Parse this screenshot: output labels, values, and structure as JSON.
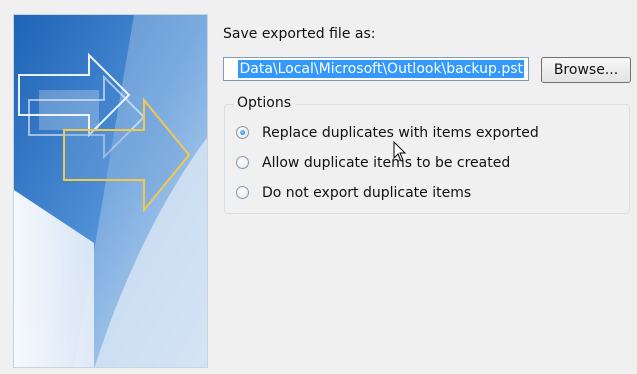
{
  "save_section": {
    "label": "Save exported file as:",
    "file_path_visible": "Data\\Local\\Microsoft\\Outlook\\backup.pst",
    "browse_label": "Browse..."
  },
  "options": {
    "legend": "Options",
    "radios": [
      {
        "label": "Replace duplicates with items exported",
        "checked": true
      },
      {
        "label": "Allow duplicate items to be created",
        "checked": false
      },
      {
        "label": "Do not export duplicate items",
        "checked": false
      }
    ]
  },
  "colors": {
    "selection": "#3399ff",
    "banner_blue": "#2f6fb8",
    "arrow_outline": "#f2c94c"
  },
  "icons": {
    "banner": "outlook-export-arrows-graphic",
    "cursor": "mouse-pointer-icon"
  }
}
